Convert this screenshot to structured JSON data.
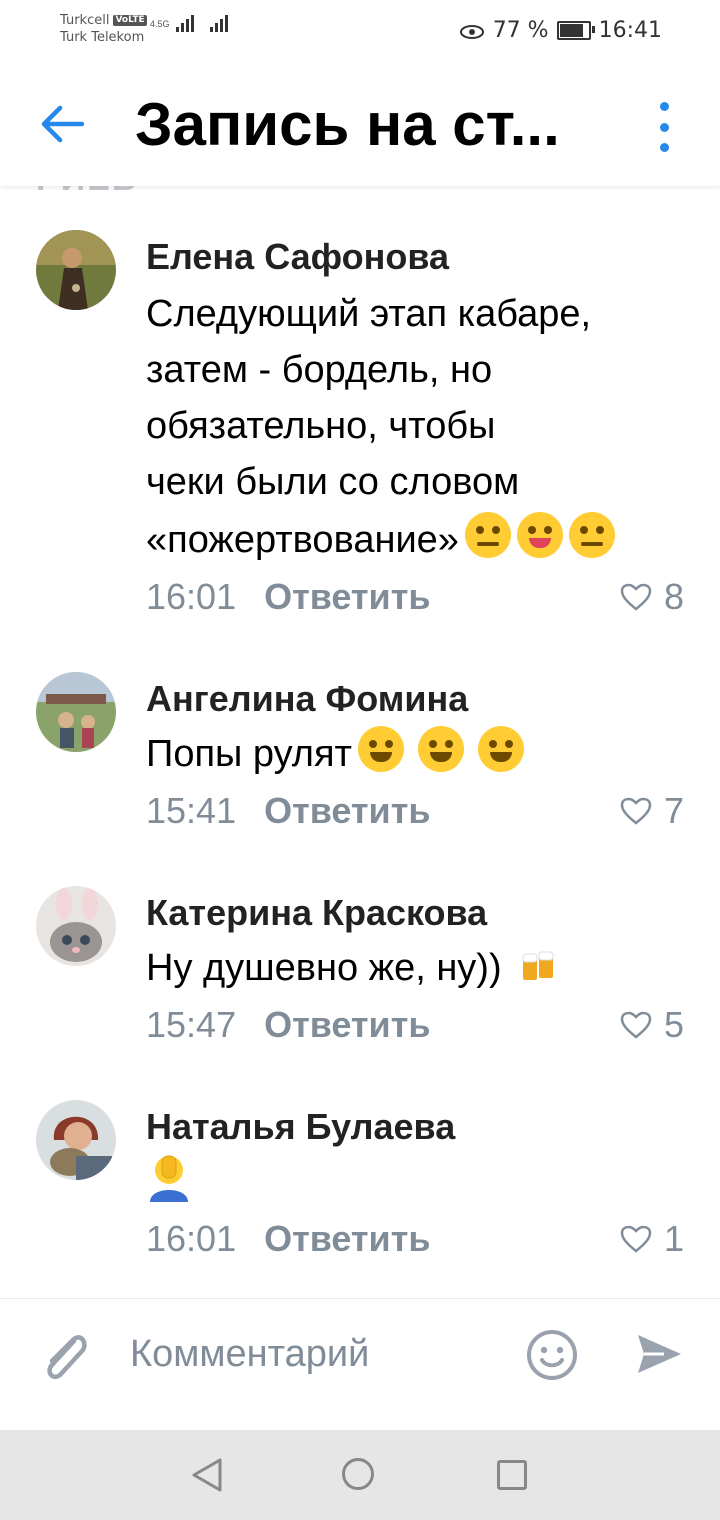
{
  "status": {
    "carrier1": "Turkcell",
    "volte": "VoLTE",
    "net_type": "4.5G",
    "carrier2": "Turk Telekom",
    "battery": "77 %",
    "battery_level": 0.77,
    "time": "16:41"
  },
  "header": {
    "title": "Запись на ст..."
  },
  "clipped_text": "РИЕВ",
  "comments": [
    {
      "author": "Елена Сафонова",
      "lines": [
        "Следующий этап кабаре,",
        "затем - бордель, но",
        "обязательно, чтобы",
        "чеки были со словом",
        "«пожертвование»"
      ],
      "time": "16:01",
      "reply": "Ответить",
      "likes": "8"
    },
    {
      "author": "Ангелина Фомина",
      "lines": [
        "Попы рулят"
      ],
      "time": "15:41",
      "reply": "Ответить",
      "likes": "7"
    },
    {
      "author": "Катерина Краскова",
      "lines": [
        "Ну душевно же, ну))"
      ],
      "time": "15:47",
      "reply": "Ответить",
      "likes": "5"
    },
    {
      "author": "Наталья Булаева",
      "lines": [
        ""
      ],
      "time": "16:01",
      "reply": "Ответить",
      "likes": "1"
    }
  ],
  "composer": {
    "placeholder": "Комментарий"
  },
  "icons": {
    "back": "arrow-left-icon",
    "more": "more-vertical-icon",
    "like": "heart-outline-icon",
    "attach": "paperclip-icon",
    "emoji": "smile-icon",
    "send": "send-icon"
  },
  "colors": {
    "accent": "#2688eb",
    "secondary_text": "#818c99"
  }
}
